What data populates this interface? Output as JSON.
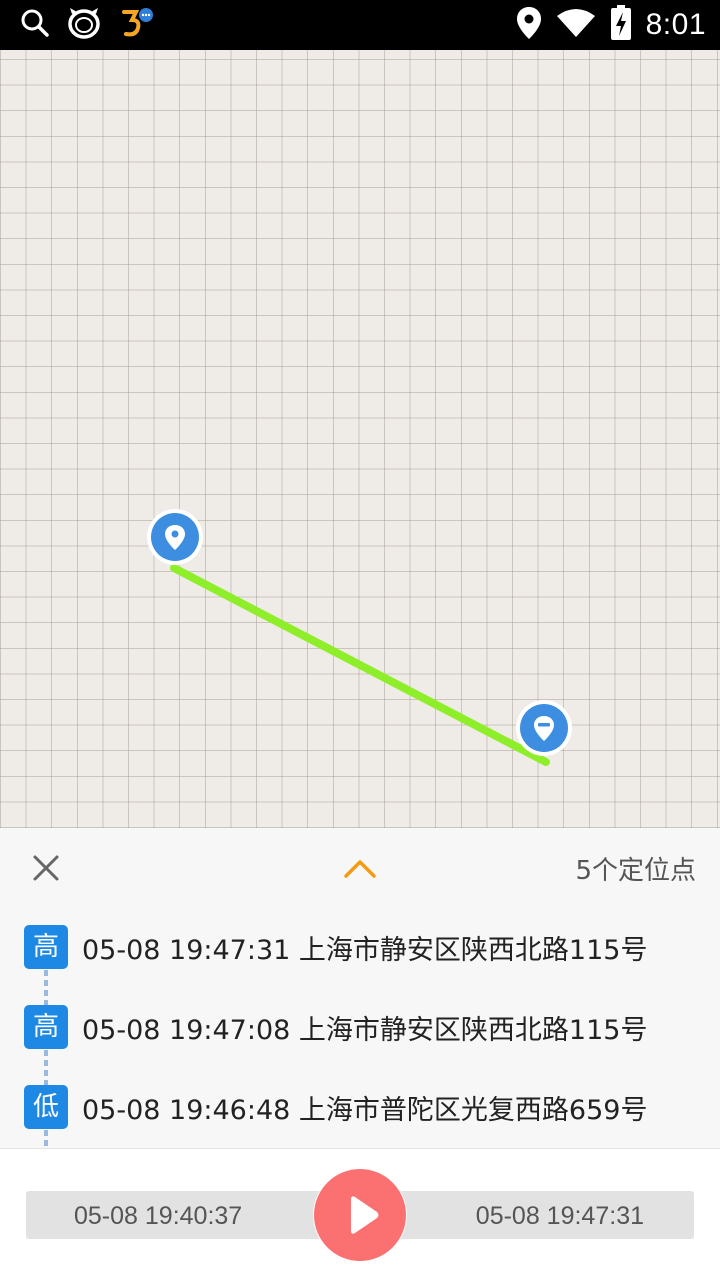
{
  "status_bar": {
    "time": "8:01",
    "left_icons": [
      "search-icon",
      "cat-app-icon",
      "app-notification-icon"
    ],
    "right_icons": [
      "location-icon",
      "wifi-icon",
      "battery-charging-icon"
    ]
  },
  "map": {
    "markers": [
      "start-marker-icon",
      "end-marker-icon"
    ],
    "route_color": "#8fee2a",
    "marker_color": "#3d8ee0"
  },
  "panel": {
    "count_label": "5个定位点",
    "accent_color": "#f39c12",
    "items": [
      {
        "badge": "高",
        "time": "05-08 19:47:31",
        "address": "上海市静安区陕西北路115号"
      },
      {
        "badge": "高",
        "time": "05-08 19:47:08",
        "address": "上海市静安区陕西北路115号"
      },
      {
        "badge": "低",
        "time": "05-08 19:46:48",
        "address": "上海市普陀区光复西路659号"
      }
    ]
  },
  "playback": {
    "start_time": "05-08 19:40:37",
    "end_time": "05-08 19:47:31",
    "button_color": "#fb7070"
  }
}
